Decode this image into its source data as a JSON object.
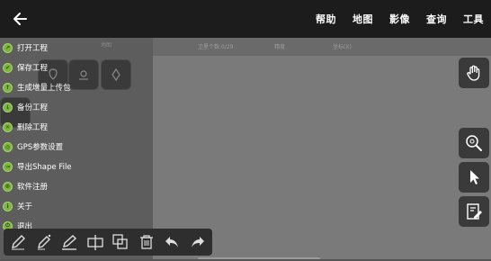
{
  "topbar": {
    "back_icon": "back-arrow-icon",
    "menu": [
      "帮助",
      "地图",
      "影像",
      "查询",
      "工具"
    ]
  },
  "status": {
    "left_text": "地图",
    "count_text": "卫星个数:0/29",
    "precision_text": "精度",
    "coord_text": "坐标(X)"
  },
  "menu_items": [
    {
      "label": "打开工程",
      "icon": "dot"
    },
    {
      "label": "保存工程",
      "icon": "dot"
    },
    {
      "label": "生成增量上传包",
      "icon": "dot"
    },
    {
      "label": "备份工程",
      "icon": "dot"
    },
    {
      "label": "删除工程",
      "icon": "dot"
    },
    {
      "label": "GPS参数设置",
      "icon": "dot"
    },
    {
      "label": "导出Shape File",
      "icon": "dot"
    },
    {
      "label": "软件注册",
      "icon": "dot"
    },
    {
      "label": "关于",
      "icon": "dot"
    },
    {
      "label": "退出",
      "icon": "dot"
    }
  ],
  "right_buttons": [
    "hand-pan-icon",
    "zoom-icon",
    "select-pointer-icon",
    "edit-note-icon"
  ],
  "bottom_tools": [
    "pencil-icon",
    "edit-line-icon",
    "edit-polygon-icon",
    "split-icon",
    "merge-icon",
    "delete-icon",
    "undo-icon",
    "redo-icon"
  ],
  "colors": {
    "topbar": "#1c1c1c",
    "accent_green": "#7db53e"
  }
}
